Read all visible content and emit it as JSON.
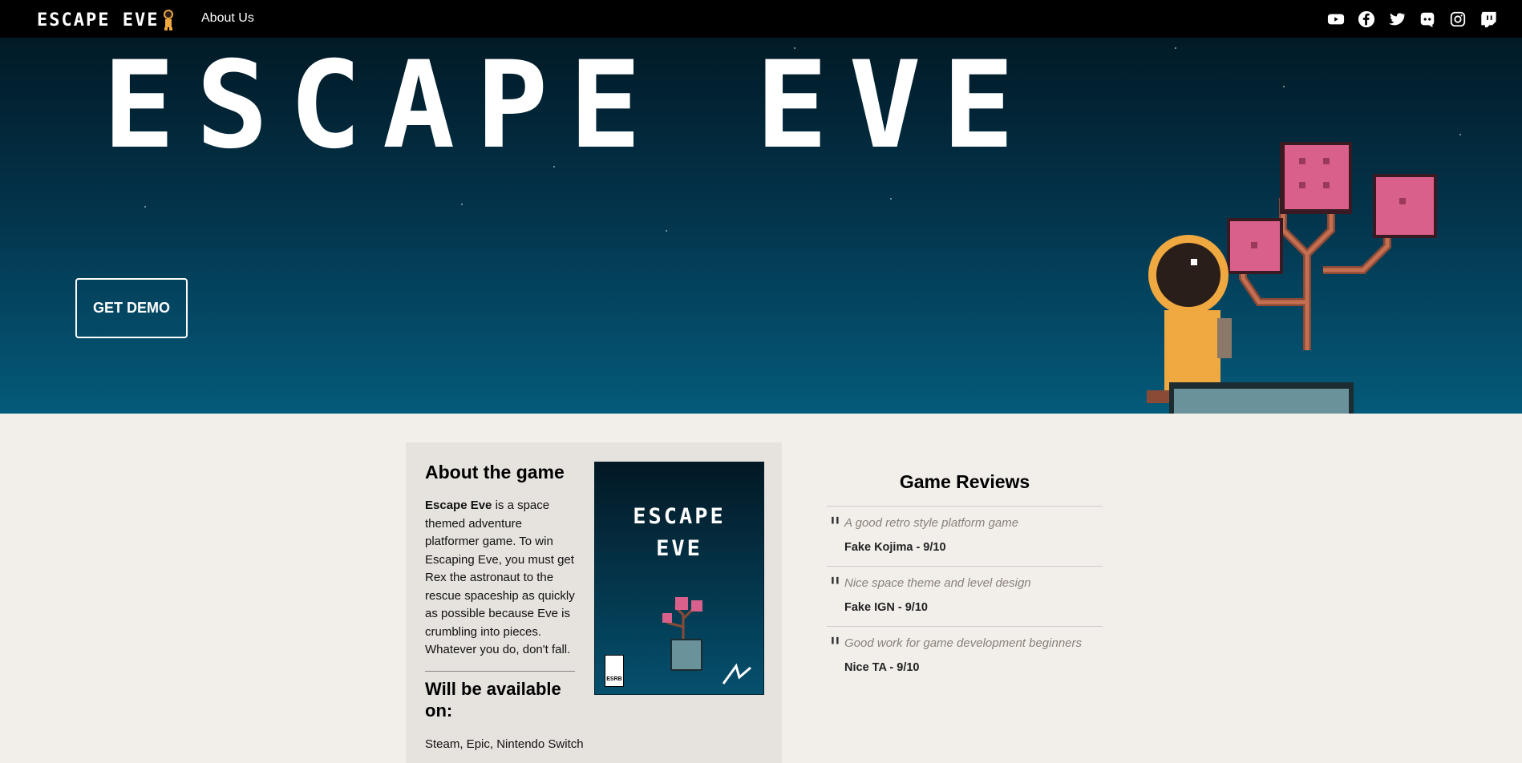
{
  "nav": {
    "brand": "ESCAPE EVE",
    "link_about": "About Us",
    "socials": [
      "youtube-icon",
      "facebook-icon",
      "twitter-icon",
      "discord-icon",
      "instagram-icon",
      "twitch-icon"
    ]
  },
  "hero": {
    "title": "ESCAPE EVE",
    "demo_button": "GET DEMO"
  },
  "about": {
    "heading": "About the game",
    "desc_bold": "Escape Eve",
    "desc_rest": " is a space themed adventure platformer game. To win Escaping Eve, you must get Rex the astronaut to the rescue spaceship as quickly as possible because Eve is crumbling into pieces. Whatever you do, don't fall.",
    "available_heading": "Will be available on:",
    "platforms": "Steam, Epic, Nintendo Switch",
    "cover_title_line1": "ESCAPE",
    "cover_title_line2": "EVE",
    "cover_rating": "ESRB"
  },
  "reviews": {
    "heading": "Game Reviews",
    "items": [
      {
        "quote": "A good retro style platform game",
        "author": "Fake Kojima - 9/10"
      },
      {
        "quote": "Nice space theme and level design",
        "author": "Fake IGN - 9/10"
      },
      {
        "quote": "Good work for game development beginners",
        "author": "Nice TA - 9/10"
      }
    ]
  },
  "colors": {
    "nav_bg": "#000000",
    "hero_top": "#021a26",
    "hero_bottom": "#045a7a",
    "page_bg": "#f2efeb",
    "about_bg": "#e6e2de",
    "astronaut": "#f0a840",
    "tree_blossom": "#d9608a"
  }
}
